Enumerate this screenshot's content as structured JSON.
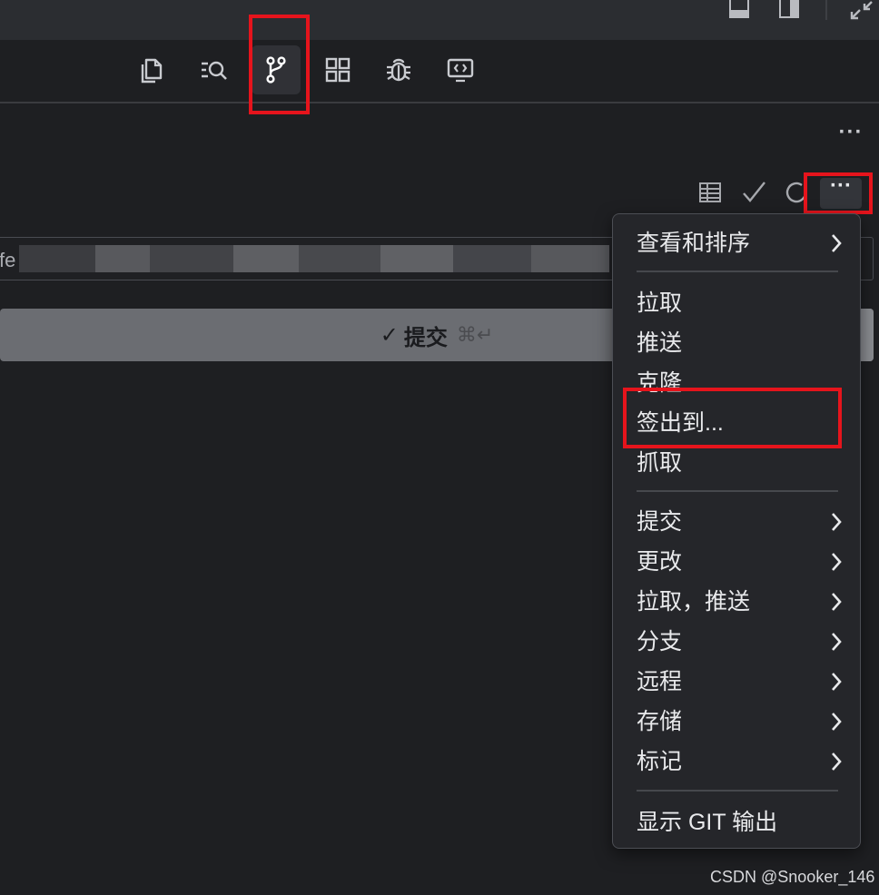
{
  "titlebar": {
    "buttons": [
      "toggle-panel-icon",
      "toggle-secondary-sidebar-icon",
      "collapse-icon"
    ]
  },
  "activity_bar": {
    "items": [
      {
        "name": "explorer",
        "icon": "files-icon"
      },
      {
        "name": "search",
        "icon": "search-icon"
      },
      {
        "name": "source-control",
        "icon": "source-control-icon",
        "active": true
      },
      {
        "name": "extensions",
        "icon": "extensions-icon"
      },
      {
        "name": "run-debug",
        "icon": "bug-icon"
      },
      {
        "name": "remote-explorer",
        "icon": "remote-icon"
      }
    ]
  },
  "scm": {
    "more_label": "···",
    "toolbar_more_label": "···",
    "message_prefix": "fe",
    "commit_label": "提交",
    "commit_shortcut": "⌘↵",
    "commit_check": "✓"
  },
  "menu": {
    "items": [
      {
        "label": "查看和排序",
        "submenu": true
      },
      {
        "label": "拉取",
        "submenu": false
      },
      {
        "label": "推送",
        "submenu": false
      },
      {
        "label": "克隆",
        "submenu": false
      },
      {
        "label": "签出到...",
        "submenu": false
      },
      {
        "label": "抓取",
        "submenu": false
      },
      {
        "label": "提交",
        "submenu": true
      },
      {
        "label": "更改",
        "submenu": true
      },
      {
        "label": "拉取，推送",
        "submenu": true
      },
      {
        "label": "分支",
        "submenu": true
      },
      {
        "label": "远程",
        "submenu": true
      },
      {
        "label": "存储",
        "submenu": true
      },
      {
        "label": "标记",
        "submenu": true
      },
      {
        "label": "显示 GIT 输出",
        "submenu": false
      }
    ]
  },
  "watermark": "CSDN @Snooker_146",
  "colors": {
    "background": "#1e1f22",
    "highlight": "#e6141c",
    "menu_bg": "#25262a"
  }
}
